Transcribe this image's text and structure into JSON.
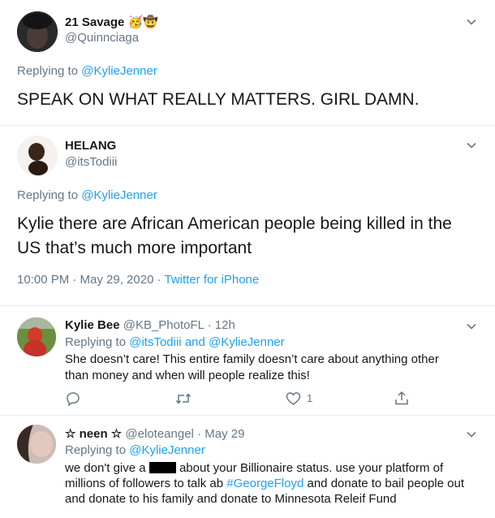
{
  "tweets": [
    {
      "name": "21 Savage",
      "emojis": [
        "🥳",
        "🤠"
      ],
      "handle": "@Quinnciaga",
      "replying_label": "Replying to",
      "replying_to": "@KylieJenner",
      "text": "SPEAK ON WHAT REALLY MATTERS. GIRL DAMN.",
      "avatar_color": "#3a3a3a"
    },
    {
      "name": "HELANG",
      "handle": "@itsTodiii",
      "replying_label": "Replying to",
      "replying_to": "@KylieJenner",
      "text_line1": "Kylie there are African American people being killed in the",
      "text_line2": "US that’s much more important",
      "timestamp": "10:00 PM · May 29, 2020",
      "dot": " · ",
      "source": "Twitter for iPhone",
      "avatar_color": "#5a4030"
    }
  ],
  "replies": [
    {
      "name": "Kylie Bee",
      "handle": "@KB_PhotoFL",
      "time": "· 12h",
      "replying_label": "Replying to",
      "replying_to_1": "@itsTodiii",
      "and_label": "and",
      "replying_to_2": "@KylieJenner",
      "text_line1": "She doesn’t care! This entire family doesn’t care about anything other",
      "text_line2": "than money and when will people realize this!",
      "like_count": "1",
      "icons": [
        "reply-icon",
        "retweet-icon",
        "like-icon",
        "share-icon"
      ],
      "avatar_color": "#c0392b"
    },
    {
      "name": "☆ neen ☆",
      "handle": "@eloteangel",
      "time": "· May 29",
      "replying_label": "Replying to",
      "replying_to": "@KylieJenner",
      "text_line1_a": "we don't give a",
      "text_line1_b": "about your Billionaire status. use your platform of",
      "text_line2_a": "millions of followers to talk ab",
      "hashtag": "#GeorgeFloyd",
      "text_line2_b": "and donate to bail people out",
      "text_line3": "and donate to his family and donate to Minnesota Releif Fund",
      "avatar_color": "#7a6a6a"
    }
  ],
  "colors": {
    "accent": "#1da1f2",
    "muted": "#657786",
    "text": "#14171a",
    "like": "#e0245e"
  }
}
